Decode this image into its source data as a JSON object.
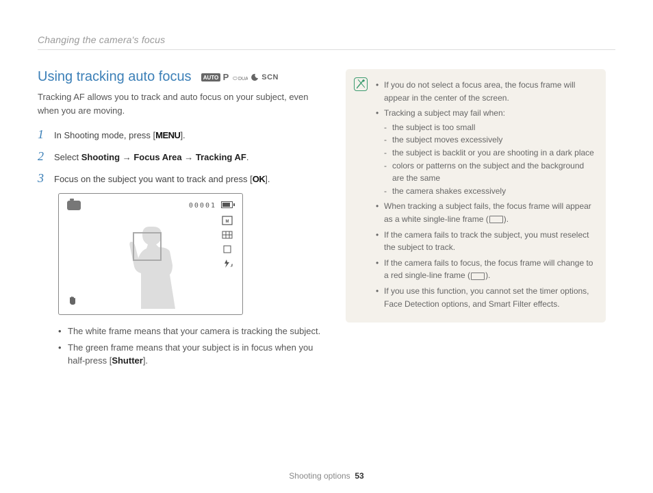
{
  "header": {
    "title": "Changing the camera's focus"
  },
  "section": {
    "title": "Using tracking auto focus",
    "mode_icons": [
      "AUTO",
      "P",
      "DUAL",
      "moon",
      "SCN"
    ],
    "intro": "Tracking AF allows you to track and auto focus on your subject, even when you are moving."
  },
  "steps": [
    {
      "num": "1",
      "pre": "In Shooting mode, press [",
      "key": "MENU",
      "post": "]."
    },
    {
      "num": "2",
      "pre": "Select ",
      "b1": "Shooting",
      "arrow1": " → ",
      "b2": "Focus Area",
      "arrow2": " → ",
      "b3": "Tracking AF",
      "post": "."
    },
    {
      "num": "3",
      "pre": "Focus on the subject you want to track and press [",
      "key": "OK",
      "post": "]."
    }
  ],
  "display": {
    "counter": "00001",
    "right_icons": [
      "14M",
      "grid",
      "single",
      "flash-a"
    ]
  },
  "notes": [
    "The white frame means that your camera is tracking the subject.",
    "The green frame means that your subject is in focus when you half-press [Shutter]."
  ],
  "info": {
    "items": [
      {
        "text": "If you do not select a focus area, the focus frame will appear in the center of the screen."
      },
      {
        "text": "Tracking a subject may fail when:",
        "sub": [
          "the subject is too small",
          "the subject moves excessively",
          "the subject is backlit or you are shooting in a dark place",
          "colors or patterns on the subject and the background are the same",
          "the camera shakes excessively"
        ]
      },
      {
        "text_pre": "When tracking a subject fails, the focus frame will appear as a white single-line frame (",
        "text_post": ")."
      },
      {
        "text": "If the camera fails to track the subject, you must reselect the subject to track."
      },
      {
        "text_pre": "If the camera fails to focus, the focus frame will change to a red single-line frame (",
        "text_post": ")."
      },
      {
        "text": "If you use this function, you cannot set the timer options, Face Detection options, and Smart Filter effects."
      }
    ]
  },
  "footer": {
    "section": "Shooting options",
    "page": "53"
  }
}
